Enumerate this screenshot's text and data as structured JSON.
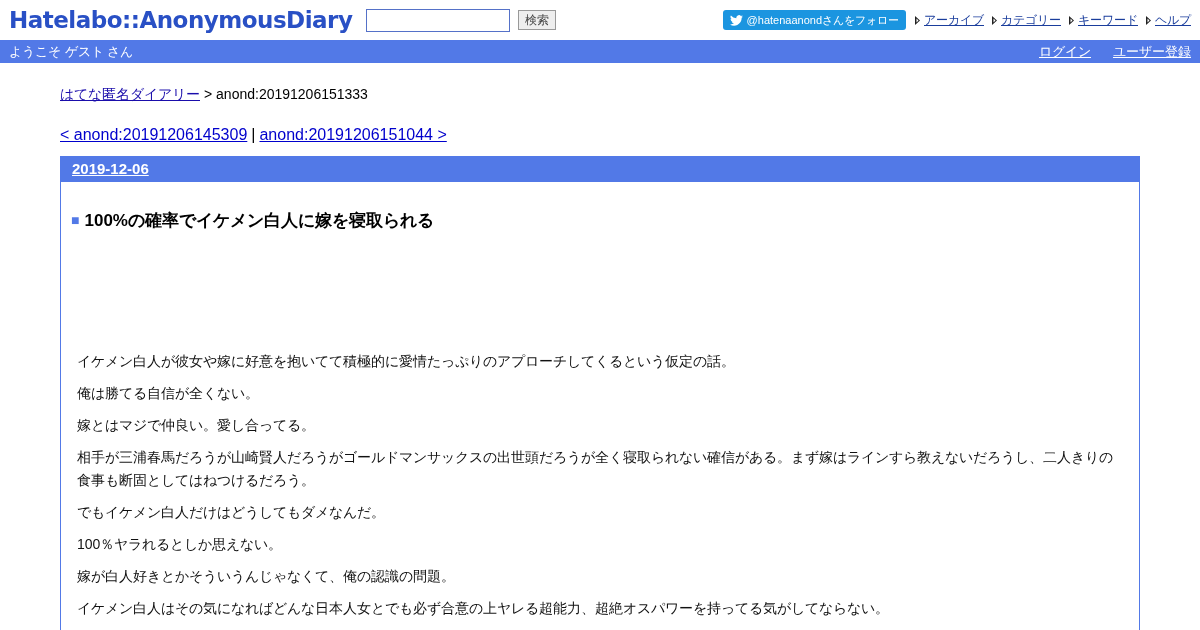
{
  "header": {
    "logo": "Hatelabo::AnonymousDiary",
    "search_button": "検索",
    "follow_button": "@hatenaanondさんをフォロー",
    "nav_links": [
      "アーカイブ",
      "カテゴリー",
      "キーワード",
      "ヘルプ"
    ]
  },
  "user_bar": {
    "welcome": "ようこそ ゲスト さん",
    "links": [
      "ログイン",
      "ユーザー登録"
    ]
  },
  "breadcrumb": {
    "link": "はてな匿名ダイアリー",
    "current": "> anond:20191206151333"
  },
  "pager": {
    "prev": "< anond:20191206145309",
    "separator": "|",
    "next": "anond:20191206151044 >"
  },
  "day": {
    "date": "2019-12-06",
    "title_mark": "■",
    "title": "100%の確率でイケメン白人に嫁を寝取られる",
    "paragraphs": [
      "イケメン白人が彼女や嫁に好意を抱いてて積極的に愛情たっぷりのアプローチしてくるという仮定の話。",
      "俺は勝てる自信が全くない。",
      "嫁とはマジで仲良い。愛し合ってる。",
      "相手が三浦春馬だろうが山崎賢人だろうがゴールドマンサックスの出世頭だろうが全く寝取られない確信がある。まず嫁はラインすら教えないだろうし、二人きりの食事も断固としてはねつけるだろう。",
      "でもイケメン白人だけはどうしてもダメなんだ。",
      "100％ヤラれるとしか思えない。",
      "嫁が白人好きとかそういうんじゃなくて、俺の認識の問題。",
      "イケメン白人はその気になればどんな日本人女とでも必ず合意の上ヤレる超能力、超絶オスパワーを持ってる気がしてならない。"
    ]
  }
}
